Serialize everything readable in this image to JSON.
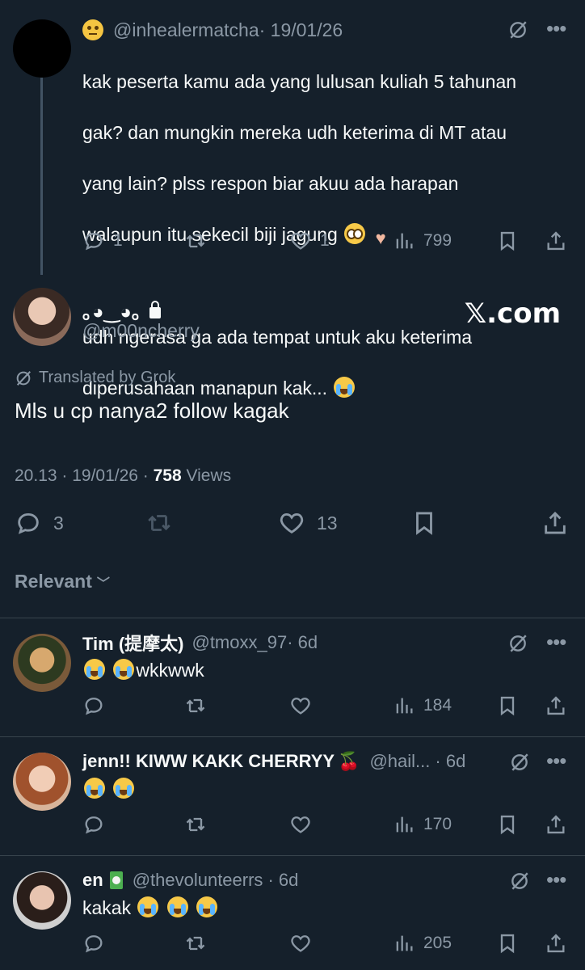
{
  "parent_tweet": {
    "handle": "@inhealermatcha",
    "date": "· 19/01/26",
    "text_line1": "kak peserta kamu ada yang lulusan kuliah 5 tahunan",
    "text_line2": "gak? dan mungkin mereka udh keterima di MT atau",
    "text_line3": "yang lain? plss respon biar akuu ada harapan",
    "text_line4": "walaupun itu sekecil biji jagung",
    "text_line5": "udh ngerasa ga ada tempat untuk aku keterima",
    "text_line6": "diperusahaan manapun kak...",
    "replies": "1",
    "likes": "1",
    "views": "799"
  },
  "main_tweet": {
    "display_name": "｡◕‿◕｡",
    "handle": "@m00ncherry",
    "watermark": "𝕏.com",
    "translated_label": "Translated by Grok",
    "text": "Mls u cp nanya2 follow kagak",
    "time": "20.13 · 19/01/26 · ",
    "views_count": "758",
    "views_label": " Views",
    "replies": "3",
    "likes": "13"
  },
  "sort_label": "Relevant",
  "replies": [
    {
      "name": "Tim (提摩太)",
      "handle": "@tmoxx_97",
      "age": "· 6d",
      "text": "wkkwwk",
      "views": "184"
    },
    {
      "name": "jenn!! KIWW KAKK CHERRYY",
      "handle": "@hail...",
      "age": "· 6d",
      "text": "",
      "views": "170"
    },
    {
      "name": "en",
      "handle": "@thevolunteerrs",
      "age": "· 6d",
      "text": "kakak",
      "views": "205"
    }
  ],
  "icons": {
    "reply": "reply-icon",
    "retweet": "retweet-icon",
    "like": "like-icon",
    "views": "views-icon",
    "bookmark": "bookmark-icon",
    "share": "share-icon",
    "grok": "grok-icon",
    "more": "more-icon",
    "lock": "lock-icon"
  },
  "colors": {
    "background": "#15202b",
    "secondary_text": "#8b98a5",
    "primary_text": "#f7f9f9",
    "divider": "#38444d"
  }
}
